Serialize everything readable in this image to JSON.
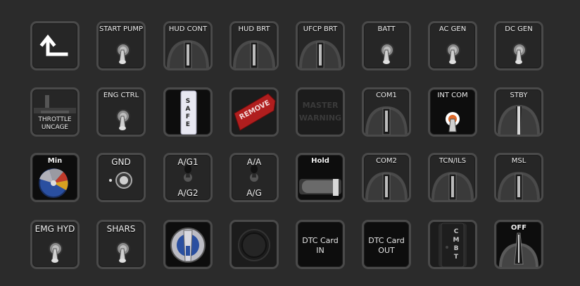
{
  "colors": {
    "background": "#2b2b2b",
    "tile_border": "#4a4a4a",
    "remove_red": "#b01e1e",
    "rwr_blue": "#2a4fa0"
  },
  "tiles": {
    "r1": [
      "",
      "START PUMP",
      "HUD CONT",
      "HUD BRT",
      "UFCP BRT",
      "BATT",
      "AC GEN",
      "DC GEN"
    ],
    "r2": [
      "THROTTLE UNCAGE",
      "ENG CTRL",
      "SAFE",
      "REMOVE",
      "MASTER WARNING",
      "COM1",
      "INT COM",
      "STBY"
    ],
    "r3": [
      "Min",
      "GND",
      "A/G1",
      "A/G2",
      "A/A",
      "A/G",
      "Hold",
      "COM2",
      "TCN/ILS",
      "MSL"
    ],
    "r4": [
      "EMG HYD",
      "SHARS",
      "DTC Card IN",
      "DTC Card OUT",
      "CMBT",
      "OFF"
    ]
  },
  "lines": {
    "throttle_1": "THROTTLE",
    "throttle_2": "UNCAGE",
    "master_1": "MASTER",
    "master_2": "WARNING",
    "dtc_in_1": "DTC Card",
    "dtc_in_2": "IN",
    "dtc_out_1": "DTC Card",
    "dtc_out_2": "OUT",
    "safe_letters": [
      "S",
      "A",
      "F",
      "E"
    ],
    "cmbt_letters": [
      "C",
      "M",
      "B",
      "T"
    ]
  },
  "icons": {
    "back": "return-arrow-icon",
    "toggle": "toggle-switch-icon",
    "rotary": "rotary-knob-icon"
  }
}
